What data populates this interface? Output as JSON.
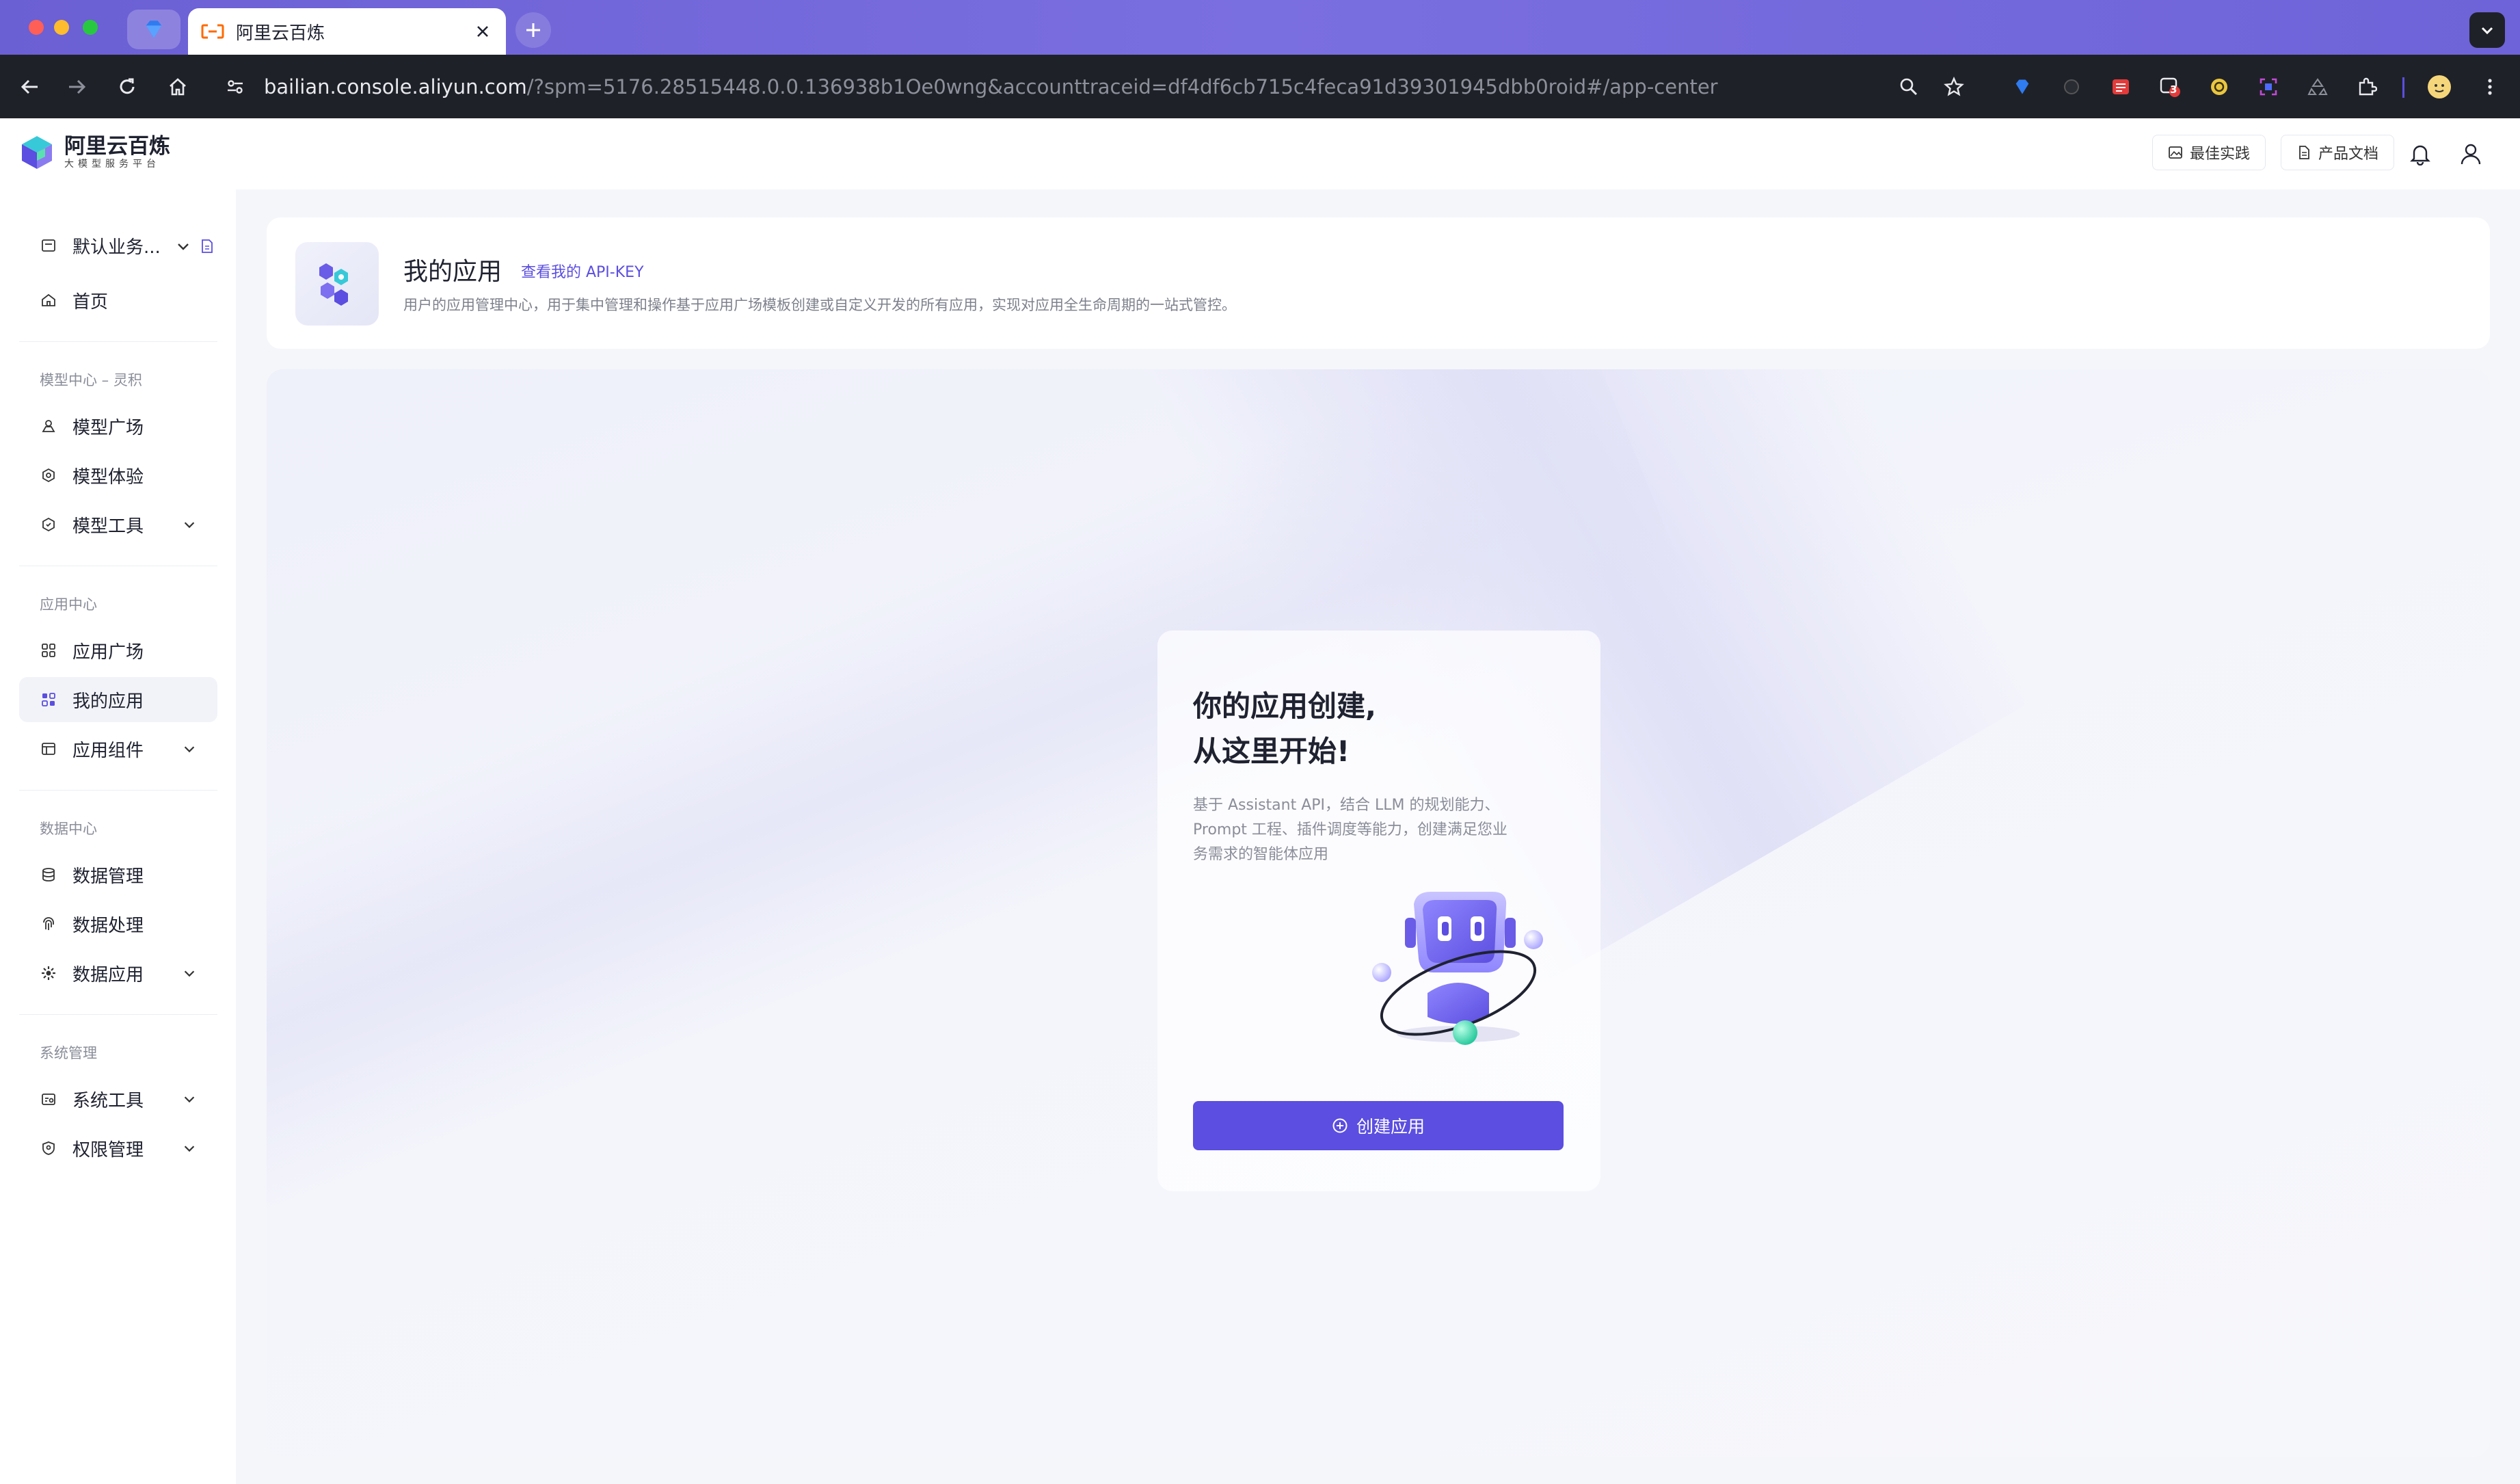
{
  "browser": {
    "tab_title": "阿里云百炼",
    "url_host": "bailian.console.aliyun.com",
    "url_rest": "/?spm=5176.28515448.0.0.136938b1Oe0wng&accounttraceid=df4df6cb715c4feca91d39301945dbb0roid#/app-center",
    "extension_badge": "3"
  },
  "header": {
    "logo_title": "阿里云百炼",
    "logo_subtitle": "大模型服务平台",
    "best_practice": "最佳实践",
    "product_docs": "产品文档"
  },
  "sidebar": {
    "workspace": "默认业务...",
    "home": "首页",
    "groups": [
      {
        "title": "模型中心 – 灵积",
        "items": [
          "模型广场",
          "模型体验",
          "模型工具"
        ]
      },
      {
        "title": "应用中心",
        "items": [
          "应用广场",
          "我的应用",
          "应用组件"
        ]
      },
      {
        "title": "数据中心",
        "items": [
          "数据管理",
          "数据处理",
          "数据应用"
        ]
      },
      {
        "title": "系统管理",
        "items": [
          "系统工具",
          "权限管理"
        ]
      }
    ],
    "active_item": "我的应用"
  },
  "page": {
    "title": "我的应用",
    "api_key_link": "查看我的 API-KEY",
    "description": "用户的应用管理中心，用于集中管理和操作基于应用广场模板创建或自定义开发的所有应用，实现对应用全生命周期的一站式管控。"
  },
  "empty_state": {
    "title_line1": "你的应用创建,",
    "title_line2": "从这里开始!",
    "description": "基于 Assistant API，结合 LLM 的规划能力、Prompt 工程、插件调度等能力，创建满足您业务需求的智能体应用",
    "create_button": "创建应用"
  },
  "colors": {
    "accent": "#5b4ee0",
    "tabbar": "#6b5fd4",
    "toolbar": "#1f2128"
  }
}
